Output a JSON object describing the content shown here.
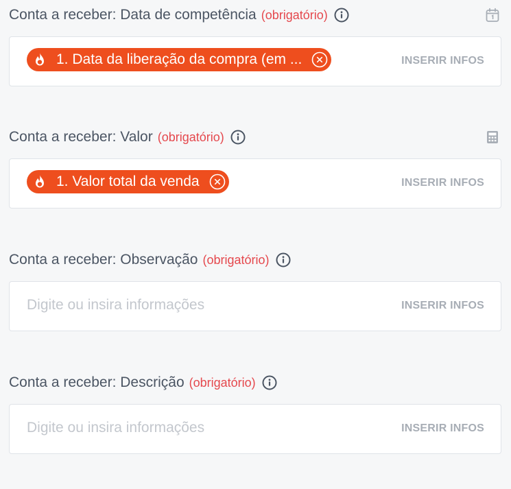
{
  "fields": [
    {
      "label": "Conta a receber: Data de competência",
      "required": "(obrigatório)",
      "type_icon": "calendar-icon",
      "chip": "1. Data da liberação da compra (em ...",
      "placeholder": "",
      "action": "INSERIR INFOS"
    },
    {
      "label": "Conta a receber: Valor",
      "required": "(obrigatório)",
      "type_icon": "calculator-icon",
      "chip": "1. Valor total da venda",
      "placeholder": "",
      "action": "INSERIR INFOS"
    },
    {
      "label": "Conta a receber: Observação",
      "required": "(obrigatório)",
      "type_icon": "",
      "chip": "",
      "placeholder": "Digite ou insira informações",
      "action": "INSERIR INFOS"
    },
    {
      "label": "Conta a receber: Descrição",
      "required": "(obrigatório)",
      "type_icon": "",
      "chip": "",
      "placeholder": "Digite ou insira informações",
      "action": "INSERIR INFOS"
    }
  ],
  "colors": {
    "chip": "#ee4e1e",
    "required": "#e5484d",
    "label": "#4b5563",
    "action": "#a7adb5",
    "placeholder": "#c3c7cd"
  },
  "icons": {
    "info": "info-icon",
    "chip": "flame-icon",
    "remove": "close-circle-icon"
  }
}
